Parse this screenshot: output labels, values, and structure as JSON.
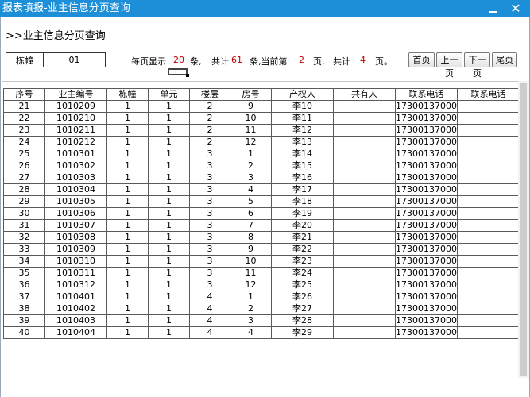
{
  "window": {
    "title": "报表填报-业主信息分页查询"
  },
  "page": {
    "title": ">>业主信息分页查询"
  },
  "filter": {
    "label": "栋幢",
    "value": "01"
  },
  "pagination": {
    "per_page_prefix": "每页显示",
    "per_page": "20",
    "per_page_unit": "条,",
    "total_prefix": "共计",
    "total": "61",
    "current_prefix": "条,当前第",
    "current": "2",
    "page_unit": "页,",
    "pages_prefix": "共计",
    "pages": "4",
    "pages_suffix": "页。",
    "buttons": {
      "first": "首页",
      "prev": "上一页",
      "next": "下一页",
      "last": "尾页"
    }
  },
  "table": {
    "headers": [
      "序号",
      "业主编号",
      "栋幢",
      "单元",
      "楼层",
      "房号",
      "产权人",
      "共有人",
      "联系电话",
      "联系电话"
    ],
    "rows": [
      [
        "21",
        "1010209",
        "1",
        "1",
        "2",
        "9",
        "李10",
        "",
        "17300137000",
        ""
      ],
      [
        "22",
        "1010210",
        "1",
        "1",
        "2",
        "10",
        "李11",
        "",
        "17300137000",
        ""
      ],
      [
        "23",
        "1010211",
        "1",
        "1",
        "2",
        "11",
        "李12",
        "",
        "17300137000",
        ""
      ],
      [
        "24",
        "1010212",
        "1",
        "1",
        "2",
        "12",
        "李13",
        "",
        "17300137000",
        ""
      ],
      [
        "25",
        "1010301",
        "1",
        "1",
        "3",
        "1",
        "李14",
        "",
        "17300137000",
        ""
      ],
      [
        "26",
        "1010302",
        "1",
        "1",
        "3",
        "2",
        "李15",
        "",
        "17300137000",
        ""
      ],
      [
        "27",
        "1010303",
        "1",
        "1",
        "3",
        "3",
        "李16",
        "",
        "17300137000",
        ""
      ],
      [
        "28",
        "1010304",
        "1",
        "1",
        "3",
        "4",
        "李17",
        "",
        "17300137000",
        ""
      ],
      [
        "29",
        "1010305",
        "1",
        "1",
        "3",
        "5",
        "李18",
        "",
        "17300137000",
        ""
      ],
      [
        "30",
        "1010306",
        "1",
        "1",
        "3",
        "6",
        "李19",
        "",
        "17300137000",
        ""
      ],
      [
        "31",
        "1010307",
        "1",
        "1",
        "3",
        "7",
        "李20",
        "",
        "17300137000",
        ""
      ],
      [
        "32",
        "1010308",
        "1",
        "1",
        "3",
        "8",
        "李21",
        "",
        "17300137000",
        ""
      ],
      [
        "33",
        "1010309",
        "1",
        "1",
        "3",
        "9",
        "李22",
        "",
        "17300137000",
        ""
      ],
      [
        "34",
        "1010310",
        "1",
        "1",
        "3",
        "10",
        "李23",
        "",
        "17300137000",
        ""
      ],
      [
        "35",
        "1010311",
        "1",
        "1",
        "3",
        "11",
        "李24",
        "",
        "17300137000",
        ""
      ],
      [
        "36",
        "1010312",
        "1",
        "1",
        "3",
        "12",
        "李25",
        "",
        "17300137000",
        ""
      ],
      [
        "37",
        "1010401",
        "1",
        "1",
        "4",
        "1",
        "李26",
        "",
        "17300137000",
        ""
      ],
      [
        "38",
        "1010402",
        "1",
        "1",
        "4",
        "2",
        "李27",
        "",
        "17300137000",
        ""
      ],
      [
        "39",
        "1010403",
        "1",
        "1",
        "4",
        "3",
        "李28",
        "",
        "17300137000",
        ""
      ],
      [
        "40",
        "1010404",
        "1",
        "1",
        "4",
        "4",
        "李29",
        "",
        "17300137000",
        ""
      ]
    ]
  },
  "icons": {
    "minimize": "minimize-icon",
    "close": "close-icon"
  }
}
